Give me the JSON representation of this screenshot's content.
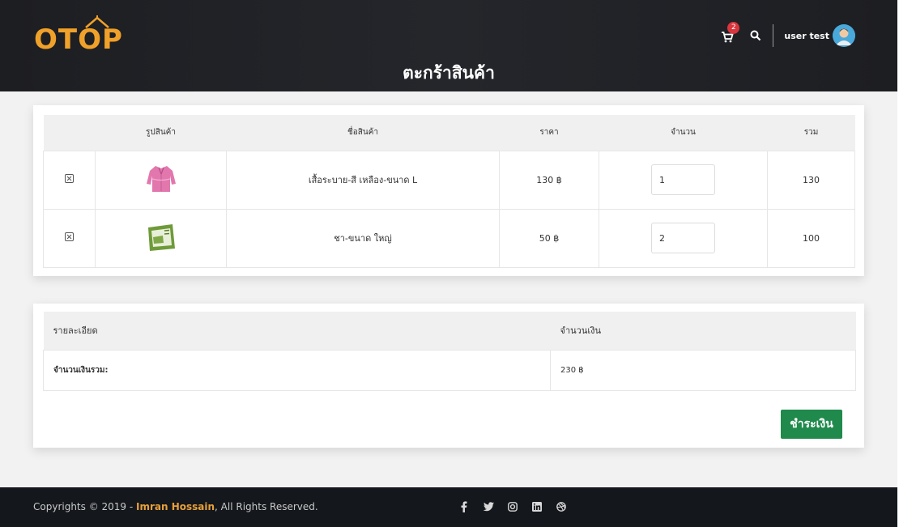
{
  "brand": {
    "logo_text": "OTOP"
  },
  "header": {
    "page_title": "ตะกร้าสินค้า",
    "cart_count": "2",
    "user_name": "user test"
  },
  "cart_table": {
    "columns": [
      "",
      "รูปสินค้า",
      "ชื่อสินค้า",
      "ราคา",
      "จำนวน",
      "รวม"
    ],
    "rows": [
      {
        "product_image": "pink-shirt-image",
        "name": "เสื้อระบาย-สี เหลือง-ขนาด L",
        "price": "130 ฿",
        "quantity": "1",
        "total": "130"
      },
      {
        "product_image": "tea-pack-image",
        "name": "ชา-ขนาด ใหญ่",
        "price": "50 ฿",
        "quantity": "2",
        "total": "100"
      }
    ]
  },
  "summary": {
    "col_detail": "รายละเอียด",
    "col_amount": "จำนวนเงิน",
    "total_label": "จำนวนเงินรวม:",
    "total_value": "230 ฿",
    "pay_button": "ชำระเงิน"
  },
  "footer": {
    "copyright_prefix": "Copyrights © 2019 - ",
    "author": "Imran Hossain",
    "copyright_suffix": ", All Rights Reserved.",
    "social_icons": [
      "facebook-icon",
      "twitter-icon",
      "instagram-icon",
      "linkedin-icon",
      "dribbble-icon"
    ]
  },
  "colors": {
    "accent": "#f0a12a",
    "pay_button": "#1f8a4c",
    "badge": "#d9363e",
    "header_bg": "#1d1e22",
    "footer_bg": "#14171c"
  }
}
